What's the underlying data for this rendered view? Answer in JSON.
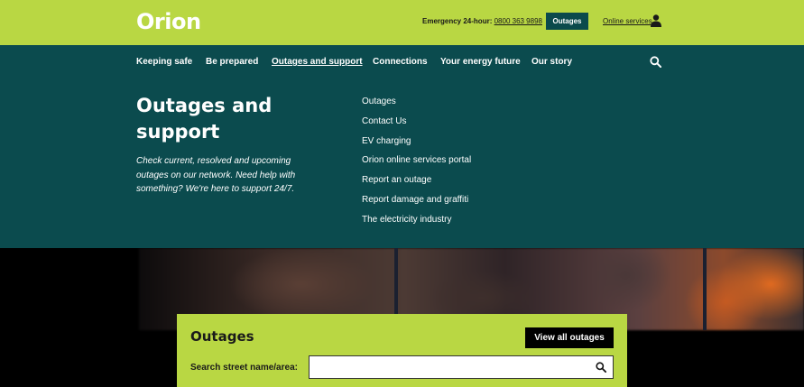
{
  "brand": {
    "logo_text": "Orion"
  },
  "topbar": {
    "emergency_label": "Emergency 24-hour:",
    "emergency_phone": "0800 363 9898",
    "outages_button": "Outages",
    "online_services": "Online services",
    "user_icon": "user-icon"
  },
  "nav": {
    "items": [
      {
        "label": "Keeping safe"
      },
      {
        "label": "Be prepared"
      },
      {
        "label": "Outages and support",
        "active": true
      },
      {
        "label": "Connections"
      },
      {
        "label": "Your energy future"
      },
      {
        "label": "Our story"
      }
    ],
    "search_icon": "search-icon"
  },
  "panel": {
    "title": "Outages and support",
    "description": "Check current, resolved and upcoming outages on our network. Need help with something? We're here to support 24/7.",
    "links": [
      {
        "label": "Outages"
      },
      {
        "label": "Contact Us"
      },
      {
        "label": "EV charging"
      },
      {
        "label": "Orion online services portal"
      },
      {
        "label": "Report an outage"
      },
      {
        "label": "Report damage and graffiti"
      },
      {
        "label": "The electricity industry"
      }
    ]
  },
  "card": {
    "title": "Outages",
    "view_all_button": "View all outages",
    "search_label": "Search street name/area:",
    "search_value": "",
    "search_icon": "search-icon"
  },
  "colors": {
    "lime": "#b9d743",
    "teal": "#0b4b4e",
    "black": "#000000",
    "white": "#ffffff"
  }
}
